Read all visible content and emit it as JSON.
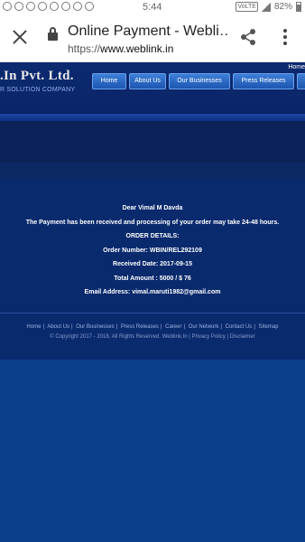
{
  "status_bar": {
    "time": "5:44",
    "network": "VoLTE",
    "battery": "82%"
  },
  "browser": {
    "title": "Online Payment - Webli…",
    "url_scheme": "https://",
    "url_host": "www.weblink.in"
  },
  "site": {
    "logo": ".In Pvt. Ltd.",
    "tagline": "R SOLUTION COMPANY",
    "home_link": "Home",
    "nav": [
      "Home",
      "About Us",
      "Our Businesses",
      "Press Releases"
    ]
  },
  "message": {
    "greeting": "Dear Vimal M Davda",
    "body": "The Payment has been received and processing of your order may take 24-48 hours.",
    "order_heading": "ORDER DETAILS:",
    "order_number": "Order Number: WBIN/REL292109",
    "received_date": "Received Date: 2017-09-15",
    "total_amount": "Total Amount : 5000 / $ 76",
    "email": "Email Address: vimal.maruti1982@gmail.com"
  },
  "footer": {
    "links": [
      "Home",
      "About Us",
      "Our Businesses",
      "Press Releases",
      "Career",
      "Our Network",
      "Contact Us",
      "Sitemap"
    ],
    "copyright": "© Copyright 2017 - 2018, All Rights Reserved. Weblink.In | Privacy Policy | Disclaimer"
  }
}
